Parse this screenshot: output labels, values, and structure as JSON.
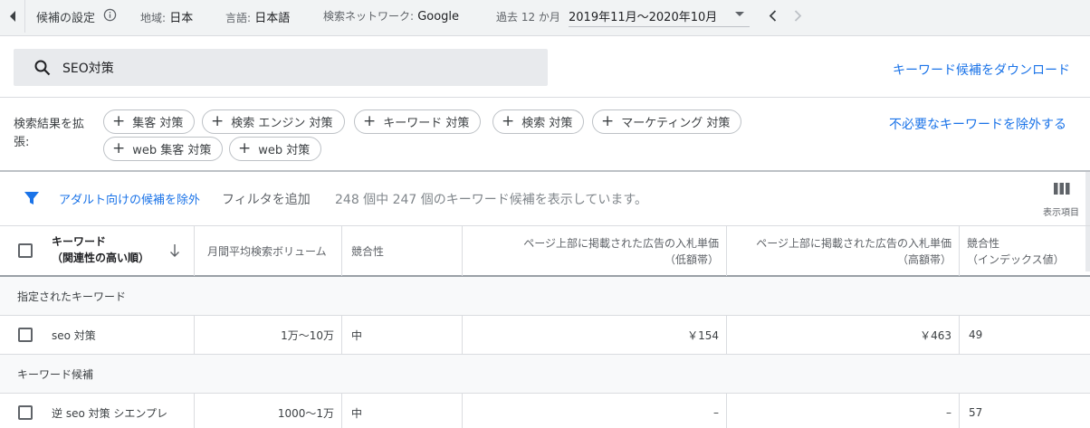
{
  "topbar": {
    "title": "候補の設定",
    "location_label": "地域:",
    "location_value": "日本",
    "language_label": "言語:",
    "language_value": "日本語",
    "network_label": "検索ネットワーク:",
    "network_value": "Google",
    "date_label": "過去 12 か月",
    "date_value": "2019年11月～2020年10月"
  },
  "search": {
    "query": "SEO対策",
    "download_label": "キーワード候補をダウンロード"
  },
  "broaden": {
    "label": "検索結果を拡張:",
    "chips": [
      "集客 対策",
      "検索 エンジン 対策",
      "キーワード 対策",
      "検索 対策",
      "マーケティング 対策",
      "web 集客 対策",
      "web 対策"
    ],
    "exclude_label": "不必要なキーワードを除外する"
  },
  "filter": {
    "adult_label": "アダルト向けの候補を除外",
    "add_label": "フィルタを追加",
    "count_text": "248 個中 247 個のキーワード候補を表示しています。",
    "columns_label": "表示項目"
  },
  "table": {
    "headers": {
      "keyword": "キーワード",
      "keyword_sub": "（関連性の高い順）",
      "volume": "月間平均検索ボリューム",
      "competition": "競合性",
      "bid_low": "ページ上部に掲載された広告の入札単価",
      "bid_low_sub": "（低額帯）",
      "bid_high": "ページ上部に掲載された広告の入札単価",
      "bid_high_sub": "（高額帯）",
      "comp_index": "競合性",
      "comp_index_sub": "（インデックス値）"
    },
    "group_specified": "指定されたキーワード",
    "group_ideas": "キーワード候補",
    "rows": [
      {
        "keyword": "seo 対策",
        "volume": "1万～10万",
        "competition": "中",
        "bid_low": "￥154",
        "bid_high": "￥463",
        "index": "49"
      },
      {
        "keyword": "逆 seo 対策 シエンプレ",
        "volume": "1000～1万",
        "competition": "中",
        "bid_low": "–",
        "bid_high": "–",
        "index": "57"
      }
    ]
  }
}
